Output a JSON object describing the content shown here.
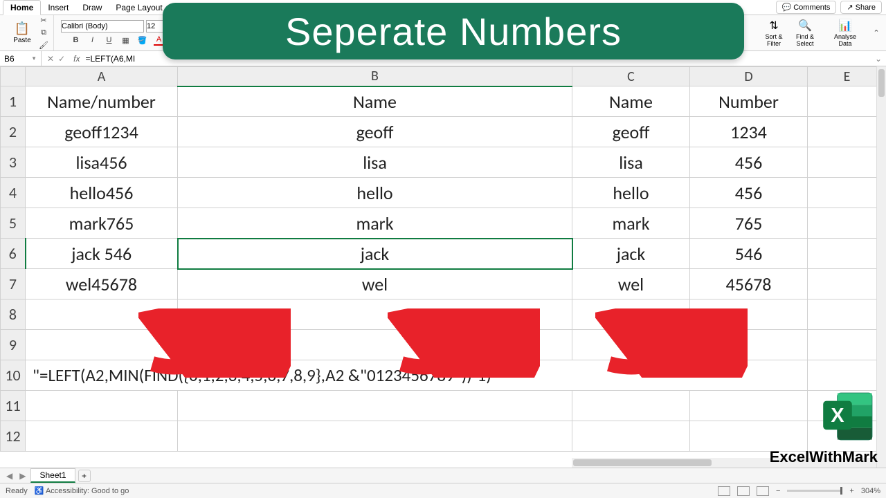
{
  "tabs": {
    "home": "Home",
    "insert": "Insert",
    "draw": "Draw",
    "page_layout": "Page Layout"
  },
  "top_right": {
    "comments": "Comments",
    "share": "Share"
  },
  "ribbon": {
    "paste": "Paste",
    "font_name": "Calibri (Body)",
    "font_size": "12",
    "bold": "B",
    "italic": "I",
    "underline": "U",
    "sort_filter": "Sort & Filter",
    "find_select": "Find & Select",
    "analyse_data": "Analyse Data"
  },
  "name_box": "B6",
  "formula_bar": "=LEFT(A6,MI",
  "banner": "Seperate Numbers",
  "columns": [
    "A",
    "B",
    "C",
    "D",
    "E"
  ],
  "col_widths": [
    "220px",
    "570px",
    "170px",
    "170px",
    "114px"
  ],
  "rows": [
    "1",
    "2",
    "3",
    "4",
    "5",
    "6",
    "7",
    "8",
    "9",
    "10",
    "11",
    "12"
  ],
  "data": {
    "A1": "Name/number",
    "B1": "Name",
    "C1": "Name",
    "D1": "Number",
    "A2": "geoff1234",
    "B2": "geoff",
    "C2": "geoff",
    "D2": "1234",
    "A3": "lisa456",
    "B3": "lisa",
    "C3": "lisa",
    "D3": "456",
    "A4": "hello456",
    "B4": "hello",
    "C4": "hello",
    "D4": "456",
    "A5": "mark765",
    "B5": "mark",
    "C5": "mark",
    "D5": "765",
    "A6": "jack 546",
    "B6": "jack",
    "C6": "jack",
    "D6": "546",
    "A7": "wel45678",
    "B7": "wel",
    "C7": "wel",
    "D7": "45678"
  },
  "formula_text": "\"=LEFT(A2,MIN(FIND({0,1,2,3,4,5,6,7,8,9},A2 &\"0123456789\"))-1)\"",
  "selected_cell": "B6",
  "sheet": {
    "name": "Sheet1",
    "add": "+"
  },
  "status": {
    "ready": "Ready",
    "accessibility": "Accessibility: Good to go",
    "zoom": "304%"
  },
  "brand": "ExcelWithMark",
  "chart_data": null
}
